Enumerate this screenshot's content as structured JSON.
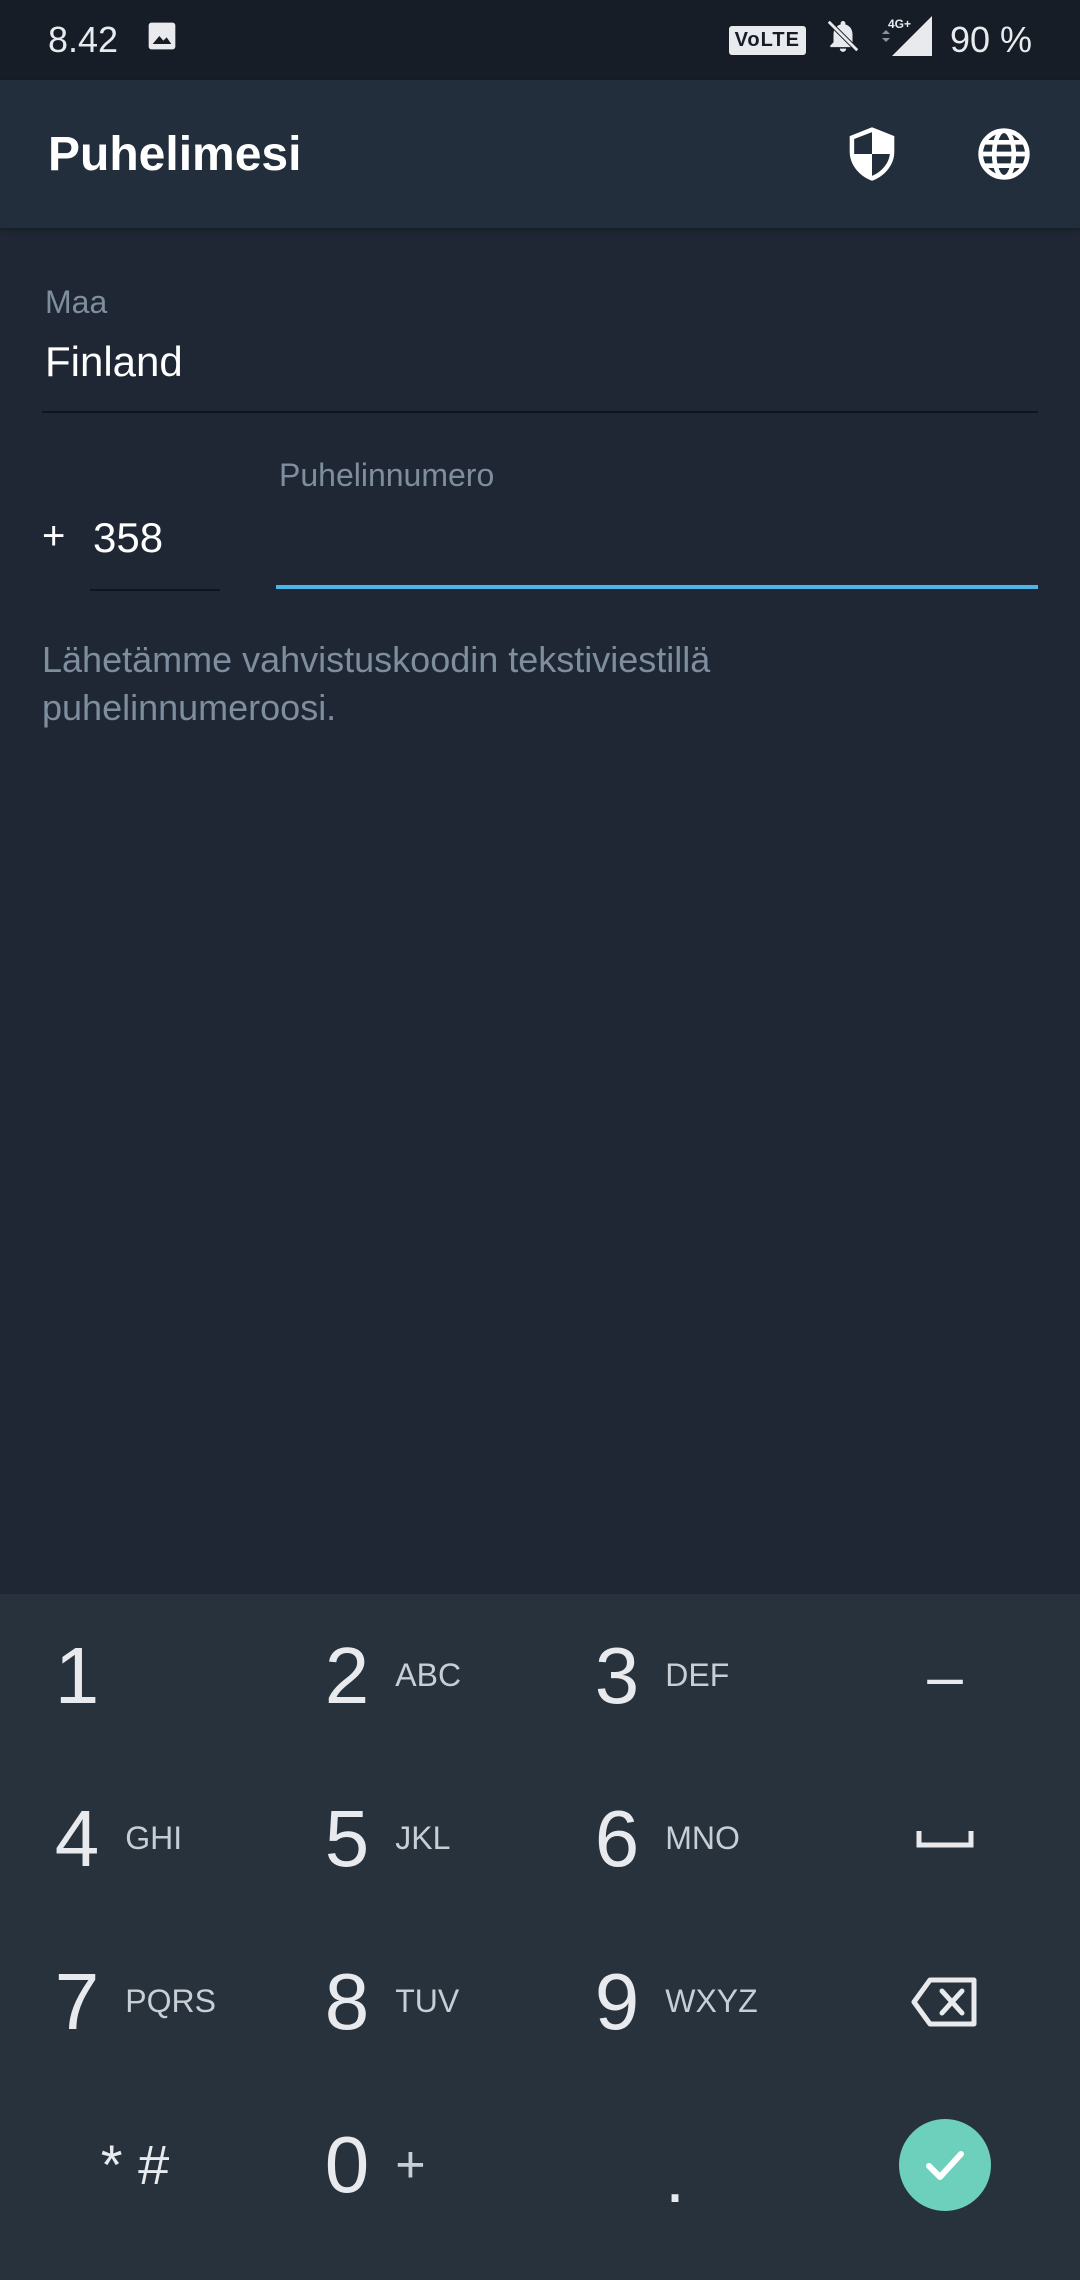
{
  "status_bar": {
    "time": "8.42",
    "volte": "VoLTE",
    "network": "4G+",
    "battery": "90 %"
  },
  "app_bar": {
    "title": "Puhelimesi"
  },
  "form": {
    "country_label": "Maa",
    "country_value": "Finland",
    "plus": "+",
    "country_code": "358",
    "phone_label": "Puhelinnumero",
    "phone_value": "",
    "hint": "Lähetämme vahvistuskoodin tekstiviestillä puhelinnumeroosi."
  },
  "keypad": {
    "keys": [
      {
        "digit": "1",
        "letters": ""
      },
      {
        "digit": "2",
        "letters": "ABC"
      },
      {
        "digit": "3",
        "letters": "DEF"
      },
      {
        "digit": "4",
        "letters": "GHI"
      },
      {
        "digit": "5",
        "letters": "JKL"
      },
      {
        "digit": "6",
        "letters": "MNO"
      },
      {
        "digit": "7",
        "letters": "PQRS"
      },
      {
        "digit": "8",
        "letters": "TUV"
      },
      {
        "digit": "9",
        "letters": "WXYZ"
      },
      {
        "digit": "0",
        "letters": "+"
      }
    ],
    "star_hash": "* #",
    "dot": ".",
    "minus": "–",
    "icons": [
      "space-icon",
      "backspace-icon",
      "check-icon"
    ],
    "done_color": "#6dd0bd"
  },
  "colors": {
    "background": "#1e2733",
    "app_bar": "#232e3c",
    "accent": "#4db6e8",
    "keypad": "#27323c"
  }
}
